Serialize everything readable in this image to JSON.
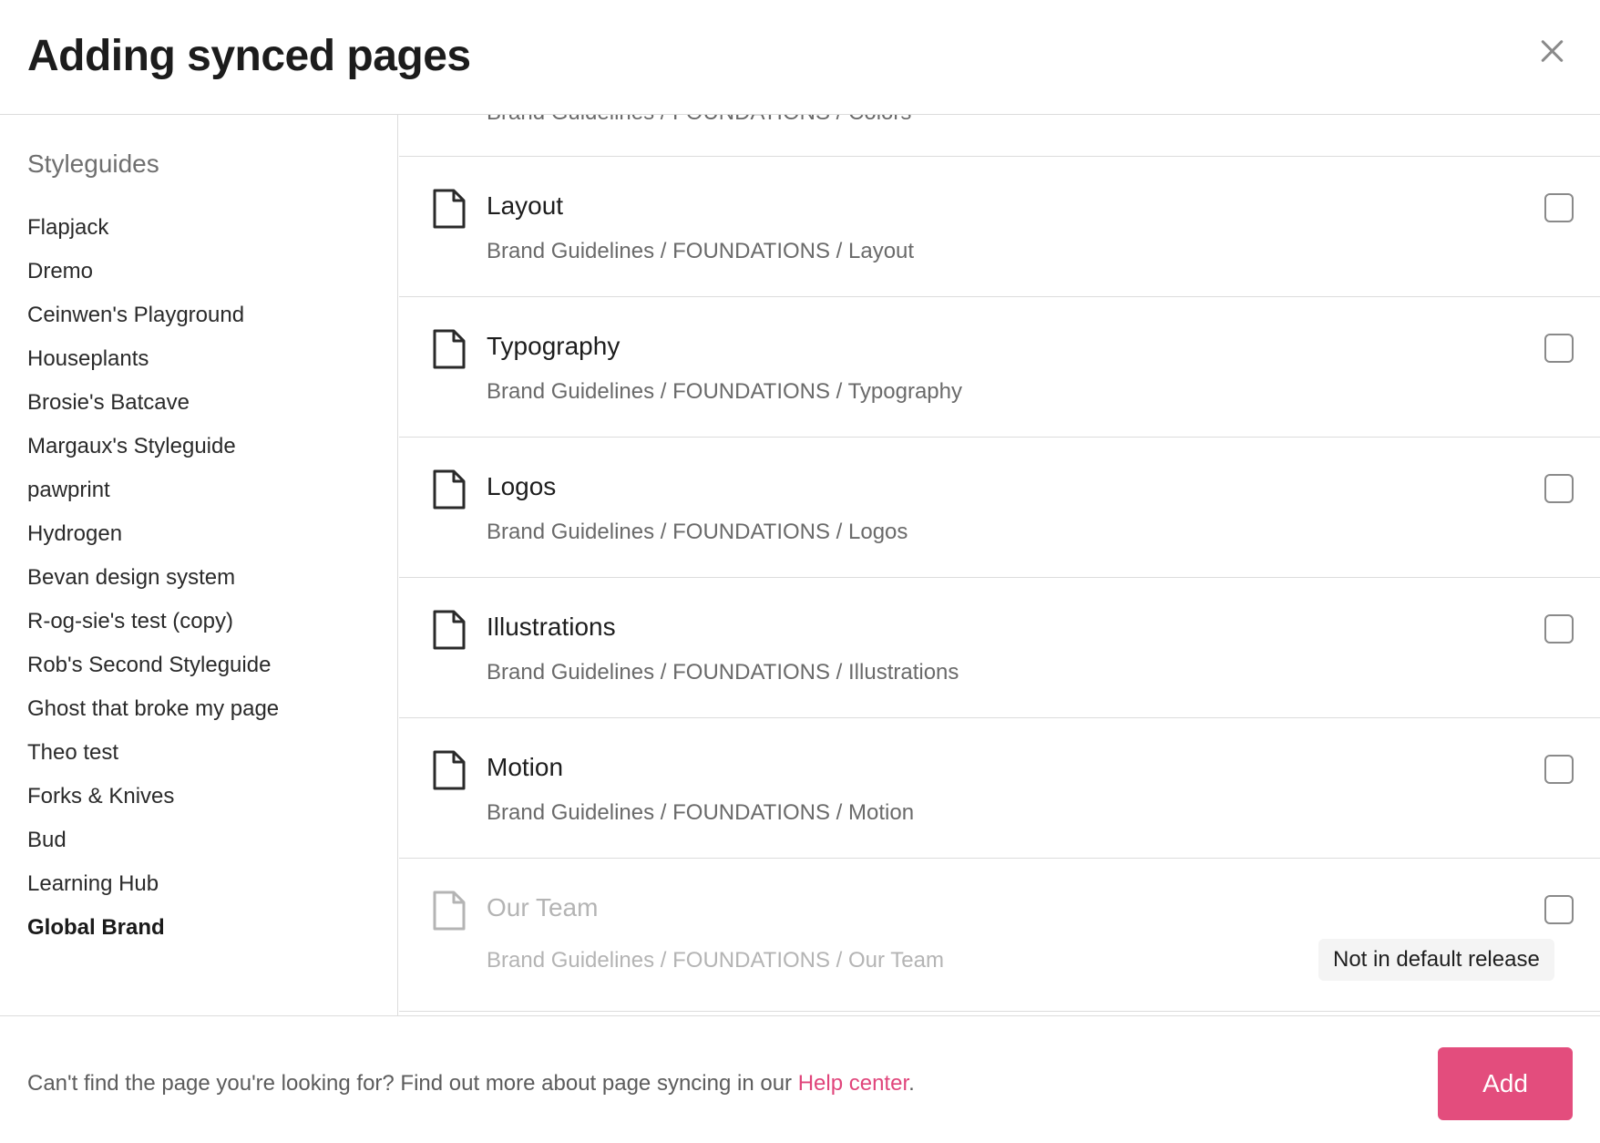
{
  "dialog": {
    "title": "Adding synced pages",
    "close_icon": "close-icon"
  },
  "sidebar": {
    "heading": "Styleguides",
    "items": [
      {
        "label": "Flapjack",
        "active": false
      },
      {
        "label": "Dremo",
        "active": false
      },
      {
        "label": "Ceinwen's Playground",
        "active": false
      },
      {
        "label": "Houseplants",
        "active": false
      },
      {
        "label": "Brosie's Batcave",
        "active": false
      },
      {
        "label": "Margaux's Styleguide",
        "active": false
      },
      {
        "label": "pawprint",
        "active": false
      },
      {
        "label": "Hydrogen",
        "active": false
      },
      {
        "label": "Bevan design system",
        "active": false
      },
      {
        "label": "R-og-sie's test (copy)",
        "active": false
      },
      {
        "label": "Rob's Second Styleguide",
        "active": false
      },
      {
        "label": "Ghost that broke my page",
        "active": false
      },
      {
        "label": "Theo test",
        "active": false
      },
      {
        "label": "Forks & Knives",
        "active": false
      },
      {
        "label": "Bud",
        "active": false
      },
      {
        "label": "Learning Hub",
        "active": false
      },
      {
        "label": "Global Brand",
        "active": true
      }
    ]
  },
  "pages": {
    "partial_path": "Brand Guidelines / FOUNDATIONS / Colors",
    "items": [
      {
        "title": "Layout",
        "path": "Brand Guidelines / FOUNDATIONS / Layout",
        "checked": false,
        "disabled": false
      },
      {
        "title": "Typography",
        "path": "Brand Guidelines / FOUNDATIONS / Typography",
        "checked": false,
        "disabled": false
      },
      {
        "title": "Logos",
        "path": "Brand Guidelines / FOUNDATIONS / Logos",
        "checked": false,
        "disabled": false
      },
      {
        "title": "Illustrations",
        "path": "Brand Guidelines / FOUNDATIONS / Illustrations",
        "checked": false,
        "disabled": false
      },
      {
        "title": "Motion",
        "path": "Brand Guidelines / FOUNDATIONS / Motion",
        "checked": false,
        "disabled": false
      },
      {
        "title": "Our Team",
        "path": "Brand Guidelines / FOUNDATIONS / Our Team",
        "checked": false,
        "disabled": true,
        "badge": "Not in default release"
      }
    ],
    "icon": "document-icon"
  },
  "footer": {
    "text_before": "Can't find the page you're looking for? Find out more about page syncing in our ",
    "link_label": "Help center",
    "text_after": ".",
    "add_label": "Add"
  },
  "colors": {
    "accent": "#e34d7d",
    "link": "#e0457b",
    "muted_text": "#6a6a6a",
    "disabled_text": "#b4b4b4"
  }
}
